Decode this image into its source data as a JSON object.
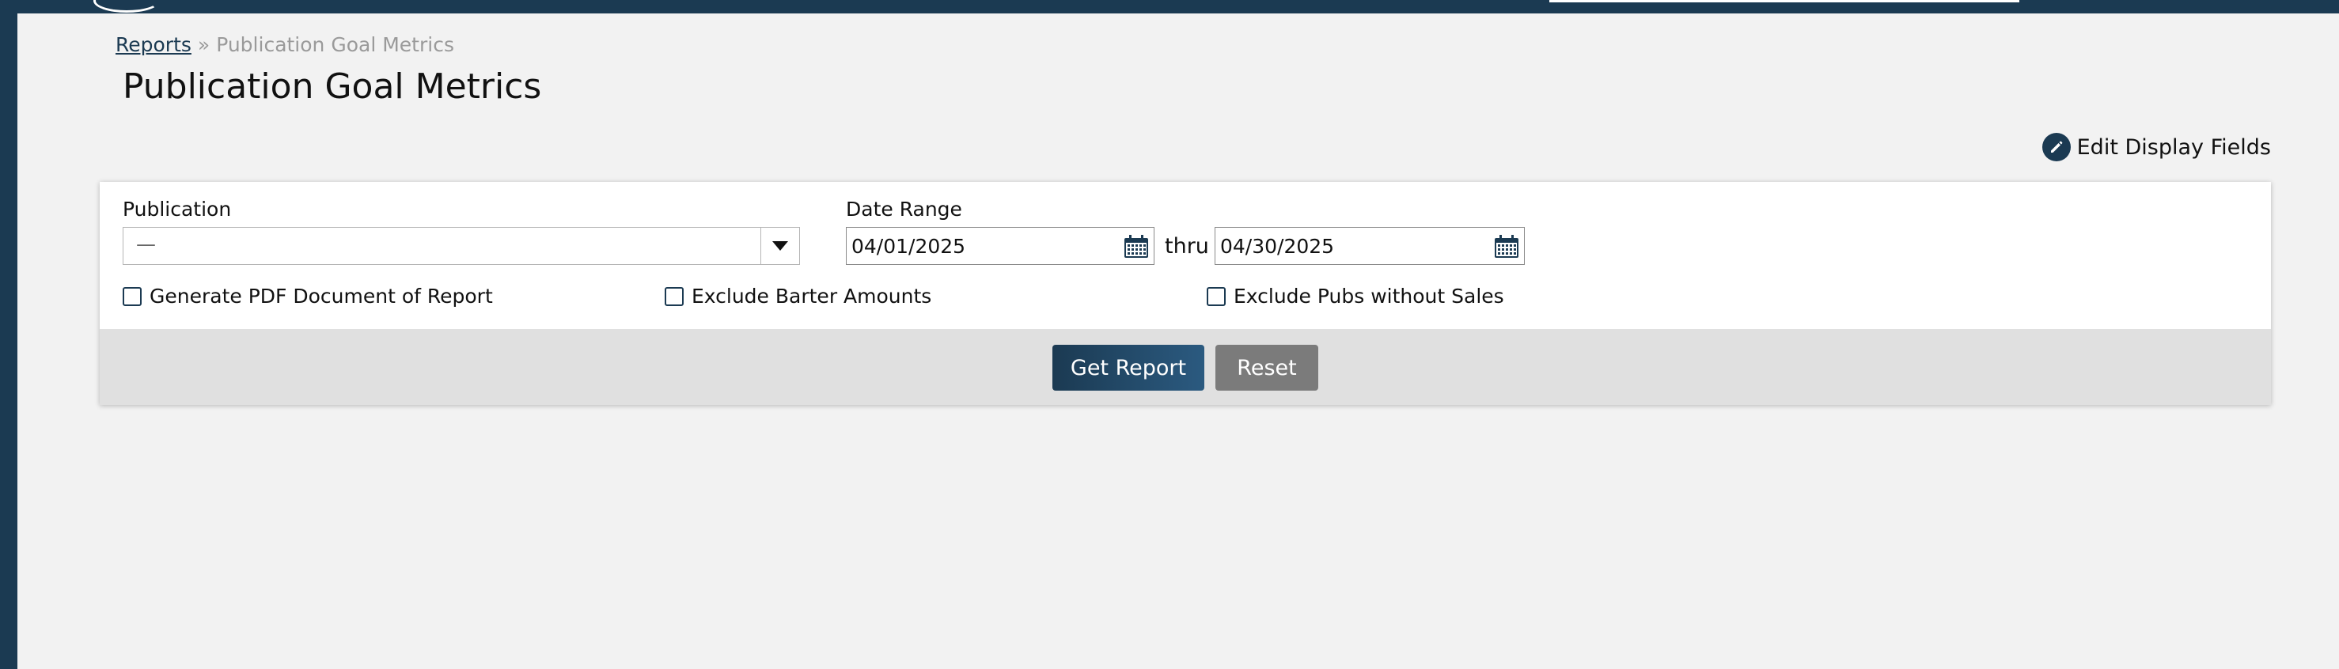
{
  "breadcrumb": {
    "root": "Reports",
    "separator": "»",
    "current": "Publication Goal Metrics"
  },
  "page": {
    "title": "Publication Goal Metrics"
  },
  "toolbar": {
    "edit_fields_label": "Edit Display Fields",
    "edit_icon": "pencil-icon"
  },
  "form": {
    "publication": {
      "label": "Publication",
      "value": "—"
    },
    "date_range": {
      "label": "Date Range",
      "start": "04/01/2025",
      "separator": "thru",
      "end": "04/30/2025"
    },
    "options": [
      {
        "label": "Generate PDF Document of Report",
        "checked": false
      },
      {
        "label": "Exclude Barter Amounts",
        "checked": false
      },
      {
        "label": "Exclude Pubs without Sales",
        "checked": false
      }
    ],
    "buttons": {
      "submit": "Get Report",
      "reset": "Reset"
    }
  },
  "colors": {
    "brand": "#1b3a52",
    "secondary_button": "#7b7b7b",
    "background": "#f2f2f2"
  }
}
